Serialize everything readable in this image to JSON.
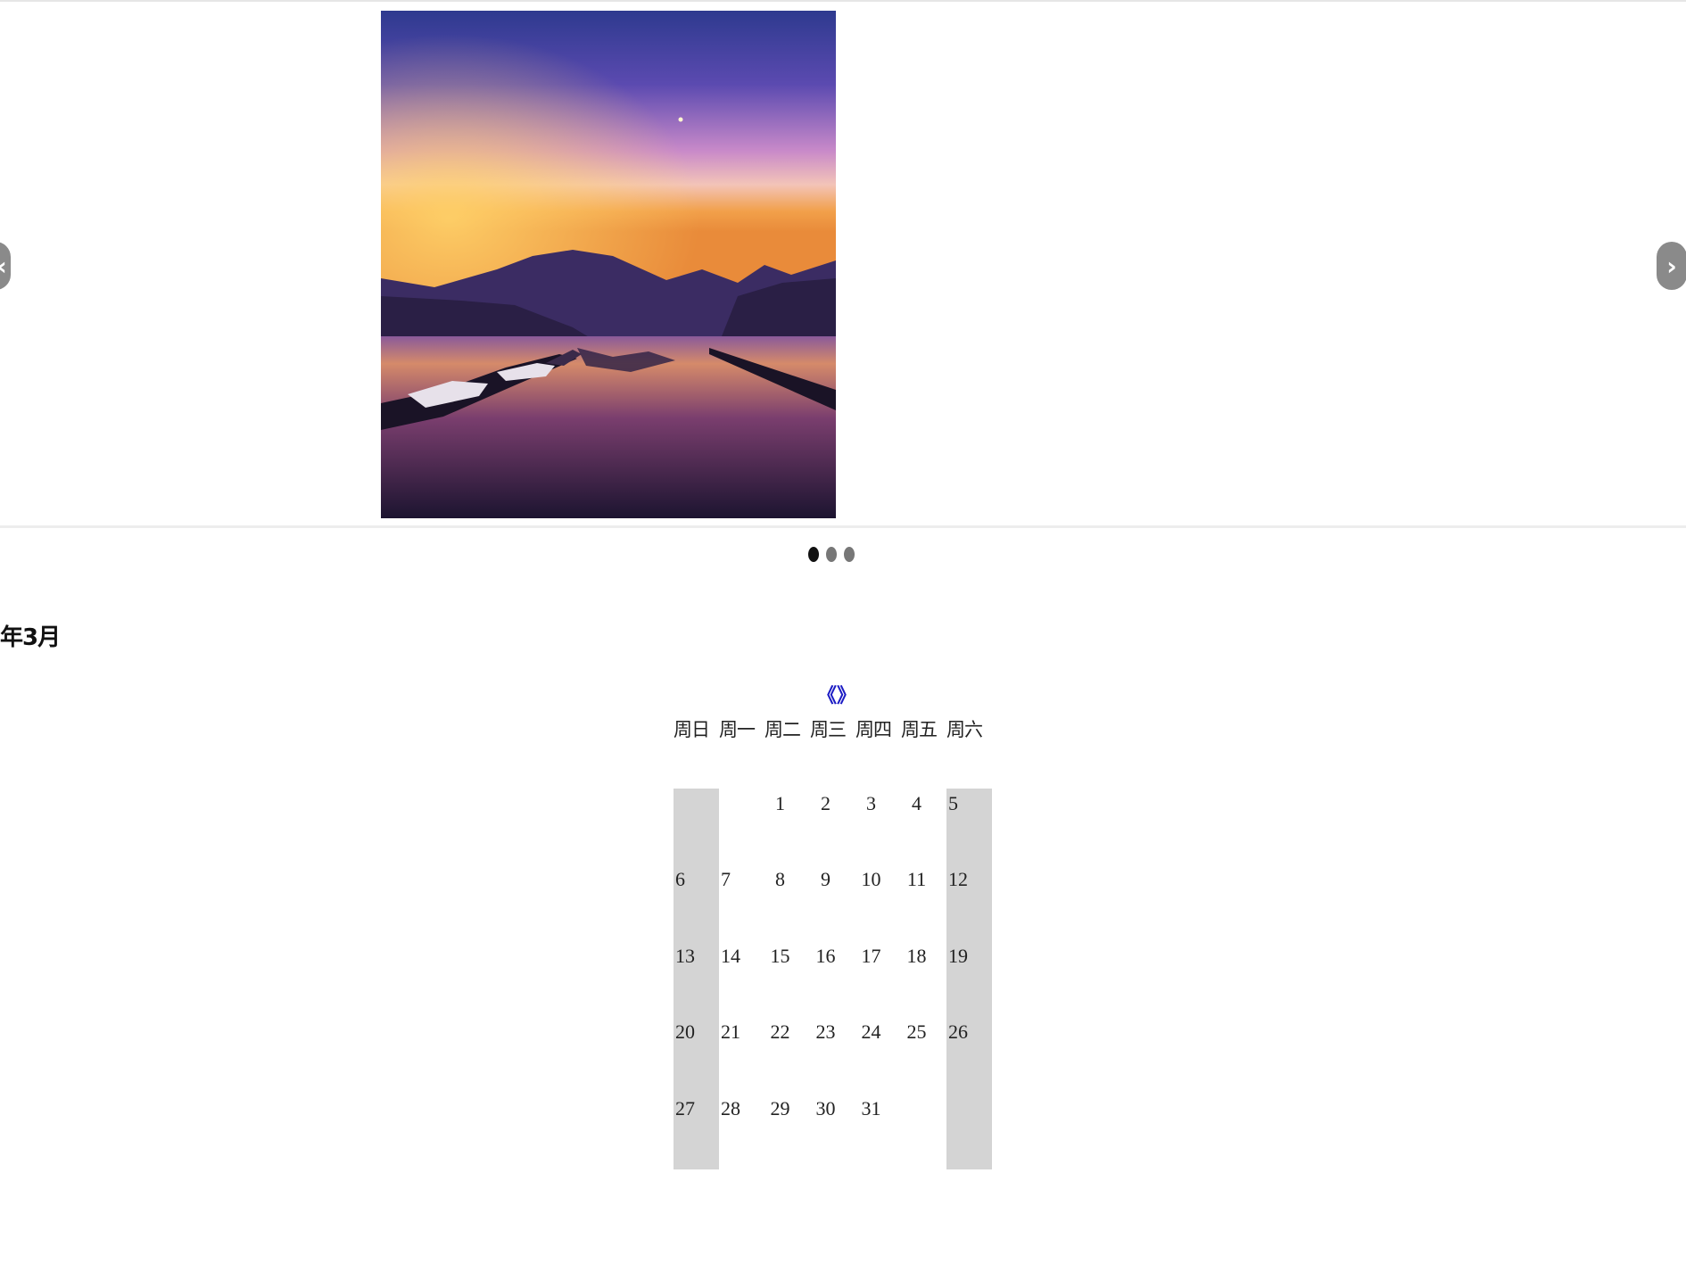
{
  "carousel": {
    "slide_image": "lake-sunset-mountains-photo",
    "prev_icon": "chevron-left-icon",
    "prev_glyph": "‹",
    "next_icon": "chevron-right-icon",
    "next_glyph": "›",
    "dots": 3,
    "active_dot": 1
  },
  "calendar": {
    "month_title": "年3月",
    "nav_prev": "《",
    "nav_next": "》",
    "nav_color": "#1b1bc4",
    "weekend_color": "#d4d4d4",
    "weekdays": [
      "周日",
      "周一",
      "周二",
      "周三",
      "周四",
      "周五",
      "周六"
    ],
    "weeks": [
      [
        "",
        "",
        "1",
        "2",
        "3",
        "4",
        "5"
      ],
      [
        "6",
        "7",
        "8",
        "9",
        "10",
        "11",
        "12"
      ],
      [
        "13",
        "14",
        "15",
        "16",
        "17",
        "18",
        "19"
      ],
      [
        "20",
        "21",
        "22",
        "23",
        "24",
        "25",
        "26"
      ],
      [
        "27",
        "28",
        "29",
        "30",
        "31",
        "",
        ""
      ]
    ]
  }
}
